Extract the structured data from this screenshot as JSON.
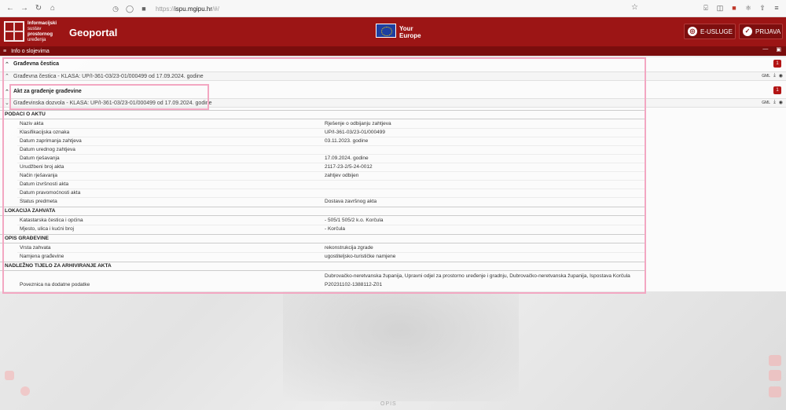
{
  "browser": {
    "url_prefix": "https://",
    "url_domain": "ispu.mgipu.hr",
    "url_suffix": "/#/"
  },
  "header": {
    "logo_lines": [
      "Informacijski",
      "sustav",
      "prostornog",
      "uređenja"
    ],
    "title": "Geoportal",
    "eu_line1": "Your",
    "eu_line2": "Europe",
    "eusluge_label": "E-USLUGE",
    "prijava_label": "PRIJAVA"
  },
  "info_bar": {
    "title": "Info o slojevima"
  },
  "sections": [
    {
      "title": "Građevna čestica",
      "count": "1",
      "row": "Građevna čestica - KLASA: UP/I-361-03/23-01/000499 od 17.09.2024. godine"
    },
    {
      "title": "Akt za građenje građevine",
      "count": "1",
      "row": "Građevinska dozvola - KLASA: UP/I-361-03/23-01/000499 od 17.09.2024. godine"
    }
  ],
  "row_icons": {
    "gml": "GML"
  },
  "details": {
    "podaci_title": "PODACI O AKTU",
    "podaci": [
      {
        "label": "Naziv akta",
        "value": "Rješenje o odbijanju zahtjeva"
      },
      {
        "label": "Klasifikacijska oznaka",
        "value": "UP/I-361-03/23-01/000499"
      },
      {
        "label": "Datum zaprimanja zahtjeva",
        "value": "03.11.2023. godine"
      },
      {
        "label": "Datum urednog zahtjeva",
        "value": ""
      },
      {
        "label": "Datum rješavanja",
        "value": "17.09.2024. godine"
      },
      {
        "label": "Urudžbeni broj akta",
        "value": "2117-23-2/5-24-0012"
      },
      {
        "label": "Način rješavanja",
        "value": "zahtjev odbijen"
      },
      {
        "label": "Datum izvršnosti akta",
        "value": ""
      },
      {
        "label": "Datum pravomoćnosti akta",
        "value": ""
      },
      {
        "label": "Status predmeta",
        "value": "Dostava završnog akta"
      }
    ],
    "lokacija_title": "LOKACIJA ZAHVATA",
    "lokacija": [
      {
        "label": "Katastarska čestica i općina",
        "value": "- 505/1 505/2 k.o. Korčula"
      },
      {
        "label": "Mjesto, ulica i kućni broj",
        "value": "- Korčula"
      }
    ],
    "opis_title": "OPIS GRAĐEVINE",
    "opis": [
      {
        "label": "Vrsta zahvata",
        "value": "rekonstrukcija zgrade"
      },
      {
        "label": "Namjena građevine",
        "value": "ugostiteljsko-turističke namjene"
      }
    ],
    "tijelo_title": "NADLEŽNO TIJELO ZA ARHIVIRANJE AKTA",
    "tijelo_value": "Dubrovačko-neretvanska županija, Upravni odjel za prostorno uređenje i gradnju, Dubrovačko-neretvanska županija, Ispostava Korčula",
    "poveznica_label": "Poveznica na dodatne podatke",
    "poveznica_value": "P20231102-1388112-Z01"
  },
  "map": {
    "footer": "OPIS"
  }
}
